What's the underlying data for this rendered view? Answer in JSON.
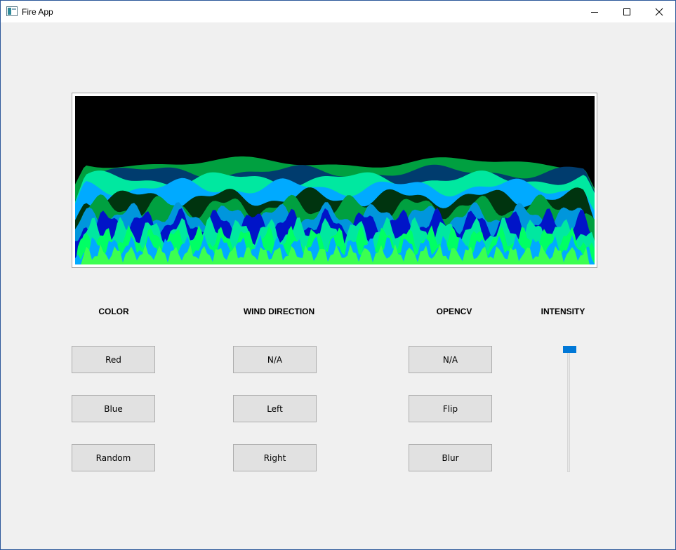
{
  "window": {
    "title": "Fire App",
    "controls": {
      "minimize": "minimize-icon",
      "maximize": "maximize-icon",
      "close": "close-icon"
    }
  },
  "sections": {
    "color": {
      "label": "COLOR",
      "buttons": [
        "Red",
        "Blue",
        "Random"
      ]
    },
    "wind": {
      "label": "WIND DIRECTION",
      "buttons": [
        "N/A",
        "Left",
        "Right"
      ]
    },
    "opencv": {
      "label": "OPENCV",
      "buttons": [
        "N/A",
        "Flip",
        "Blur"
      ]
    },
    "intensity": {
      "label": "INTENSITY",
      "value_fraction": 1.0
    }
  },
  "colors": {
    "accent": "#0078d7",
    "fire_palette": [
      "#00a040",
      "#003c6e",
      "#00e8a0",
      "#00aaff",
      "#00340f",
      "#0014c8",
      "#00ff64",
      "#0096dc",
      "#3cff50"
    ]
  }
}
